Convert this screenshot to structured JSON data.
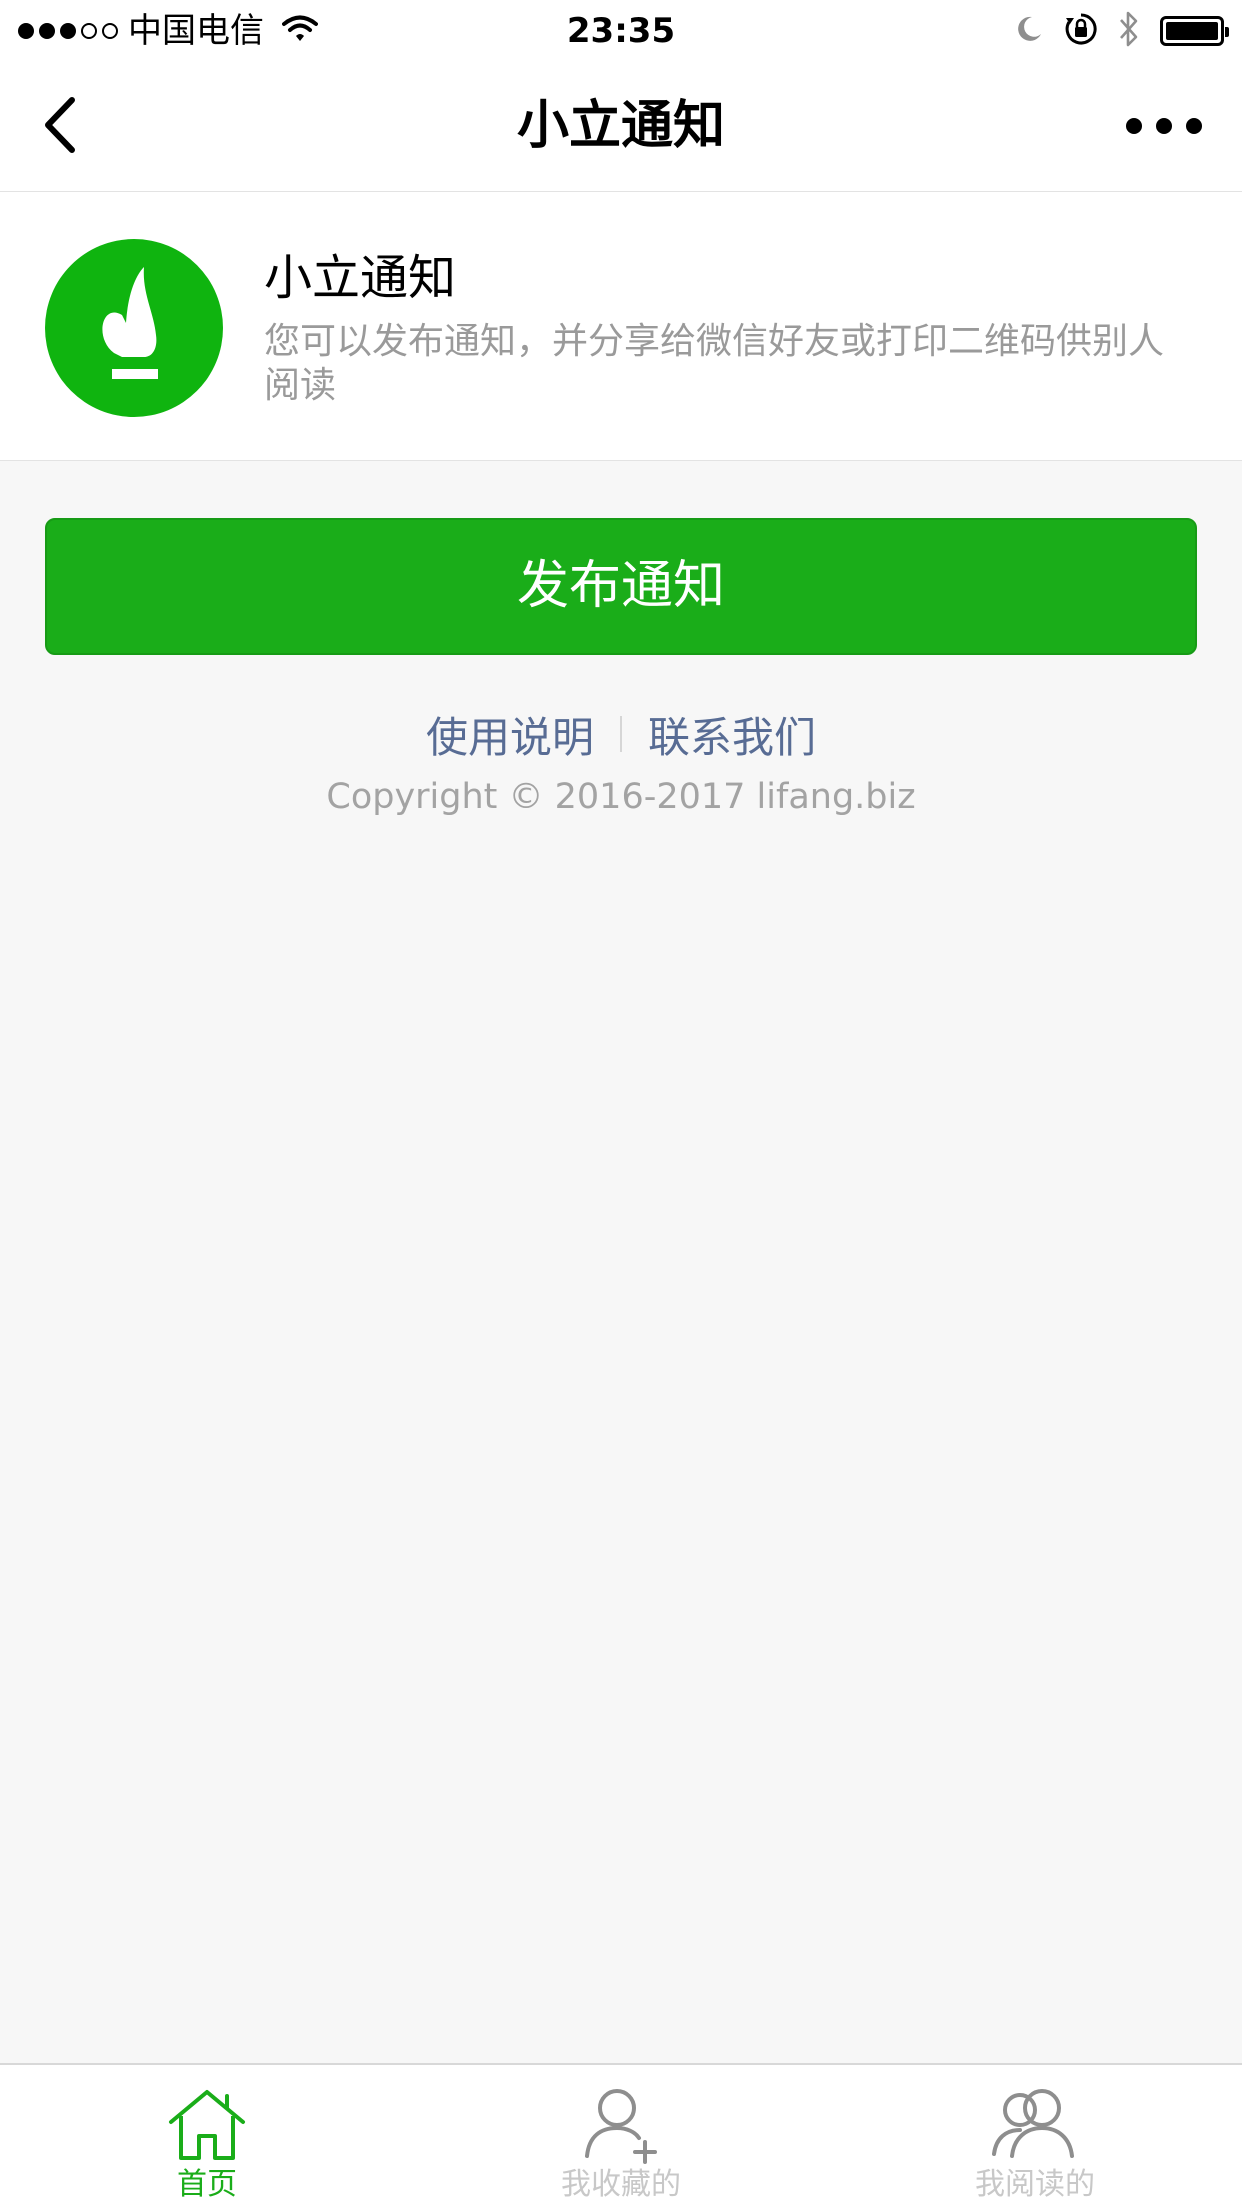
{
  "status_bar": {
    "carrier": "中国电信",
    "time": "23:35"
  },
  "nav": {
    "title": "小立通知"
  },
  "header": {
    "app_name": "小立通知",
    "description": "您可以发布通知，并分享给微信好友或打印二维码供别人阅读"
  },
  "main": {
    "publish_label": "发布通知",
    "links": {
      "instructions": "使用说明",
      "contact": "联系我们"
    },
    "copyright": "Copyright © 2016-2017 lifang.biz"
  },
  "tabbar": {
    "items": [
      {
        "label": "首页",
        "icon": "home-icon",
        "active": true
      },
      {
        "label": "我收藏的",
        "icon": "add-user-icon",
        "active": false
      },
      {
        "label": "我阅读的",
        "icon": "group-icon",
        "active": false
      }
    ]
  },
  "colors": {
    "brand_green": "#1aad19",
    "logo_green": "#0fb40f",
    "link_blue": "#586c94",
    "inactive_tab": "#c8c8c8"
  }
}
